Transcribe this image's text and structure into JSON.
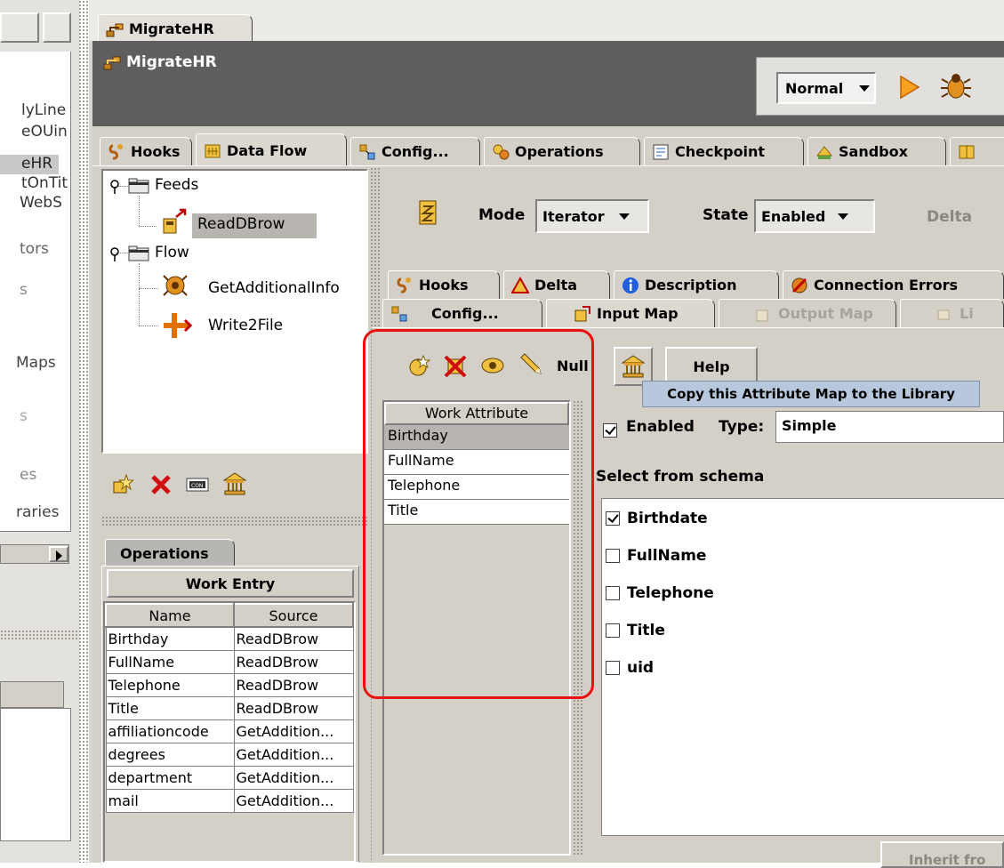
{
  "left_panel": {
    "partial_labels": [
      "lyLine",
      "eOUin",
      "eHR",
      "tOnTit",
      "WebS",
      "tors",
      "s",
      "Maps",
      "s",
      "es",
      "raries"
    ]
  },
  "window_tab": {
    "label": "MigrateHR"
  },
  "header": {
    "title": "MigrateHR",
    "run_mode": "Normal"
  },
  "main_tabs": [
    {
      "label": "Hooks"
    },
    {
      "label": "Data Flow"
    },
    {
      "label": "Config..."
    },
    {
      "label": "Operations"
    },
    {
      "label": "Checkpoint"
    },
    {
      "label": "Sandbox"
    }
  ],
  "tree": {
    "feeds": {
      "label": "Feeds",
      "children": [
        "ReadDBrow"
      ]
    },
    "flow": {
      "label": "Flow",
      "children": [
        "GetAdditionalInfo",
        "Write2File"
      ]
    }
  },
  "component": {
    "mode_label": "Mode",
    "mode_value": "Iterator",
    "state_label": "State",
    "state_value": "Enabled",
    "delta_label": "Delta"
  },
  "component_tabs_row1": [
    {
      "label": "Hooks"
    },
    {
      "label": "Delta"
    },
    {
      "label": "Description"
    },
    {
      "label": "Connection Errors"
    }
  ],
  "component_tabs_row2": [
    {
      "label": "Config..."
    },
    {
      "label": "Input Map"
    },
    {
      "label": "Output Map"
    },
    {
      "label": "Li"
    }
  ],
  "map_toolbar": {
    "null_label": "Null",
    "help_label": "Help",
    "tooltip": "Copy this Attribute Map to the Library"
  },
  "work_attribute": {
    "header": "Work Attribute",
    "items": [
      "Birthday",
      "FullName",
      "Telephone",
      "Title"
    ],
    "selected": "Birthday"
  },
  "map_detail": {
    "enabled_label": "Enabled",
    "enabled_checked": true,
    "type_label": "Type:",
    "type_value": "Simple",
    "schema_label": "Select from schema",
    "schema_items": [
      {
        "label": "Birthdate",
        "checked": true
      },
      {
        "label": "FullName",
        "checked": false
      },
      {
        "label": "Telephone",
        "checked": false
      },
      {
        "label": "Title",
        "checked": false
      },
      {
        "label": "uid",
        "checked": false
      }
    ],
    "inherit_label": "Inherit fro"
  },
  "operations_panel": {
    "tab_label": "Operations",
    "work_entry_label": "Work Entry",
    "columns": [
      "Name",
      "Source"
    ],
    "rows": [
      [
        "Birthday",
        "ReadDBrow"
      ],
      [
        "FullName",
        "ReadDBrow"
      ],
      [
        "Telephone",
        "ReadDBrow"
      ],
      [
        "Title",
        "ReadDBrow"
      ],
      [
        "affiliationcode",
        "GetAddition..."
      ],
      [
        "degrees",
        "GetAddition..."
      ],
      [
        "department",
        "GetAddition..."
      ],
      [
        "mail",
        "GetAddition..."
      ]
    ]
  },
  "colors": {
    "panel": "#d4d0c8",
    "header_dark": "#5e5e5e",
    "selection": "#b8b4b0",
    "highlight_box": "#e81010",
    "tooltip_bg": "#b8c8dc"
  }
}
